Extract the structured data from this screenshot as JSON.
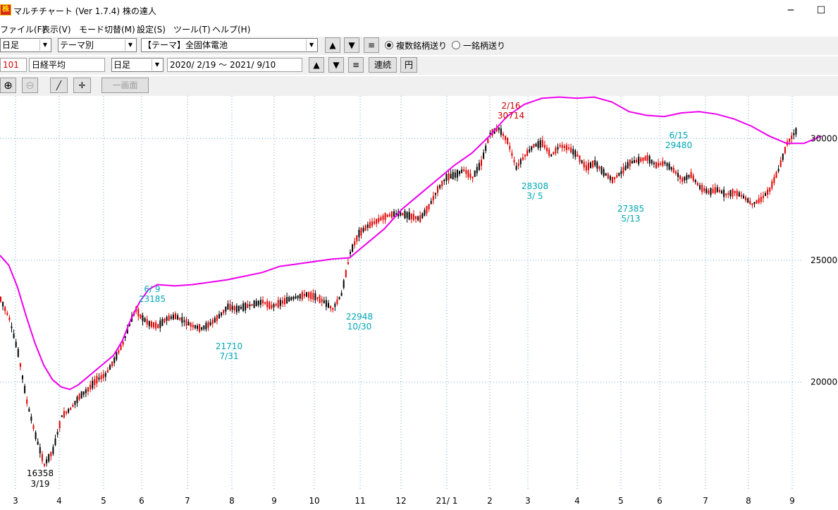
{
  "window": {
    "app_icon_text": "株",
    "title": "マルチチャート (Ver 1.7.4)  株の達人",
    "minimize": "─",
    "maximize": "☐"
  },
  "menu": [
    "ファイル(F)",
    "表示(V)",
    "モード切替(M)",
    "設定(S)",
    "ツール(T)",
    "ヘルプ(H)"
  ],
  "toolbar1": {
    "period": "日足",
    "list_type": "テーマ別",
    "theme": "【テーマ】全固体電池",
    "up_label": "▲",
    "down_label": "▼",
    "list_label": "≡",
    "radio_multi_label": "複数銘柄送り",
    "radio_single_label": "一銘柄送り"
  },
  "toolbar2": {
    "code": "101",
    "name": "日経平均",
    "period": "日足",
    "date_range": "2020/ 2/19 ～  2021/ 9/10",
    "up_label": "▲",
    "down_label": "▼",
    "list_label": "≡",
    "continuous_label": "連続",
    "yen_label": "円"
  },
  "toolbar3": {
    "zoom_in": "⊕",
    "zoom_out": "⊖",
    "line_tool": "╱",
    "crosshair": "✛",
    "single_screen": "一画面"
  },
  "chart_data": {
    "type": "candlestick",
    "y_ticks": [
      20000,
      25000,
      30000
    ],
    "x_ticks": [
      "3",
      "4",
      "5",
      "6",
      "7",
      "8",
      "9",
      "10",
      "11",
      "12",
      "21/ 1",
      "2",
      "3",
      "4",
      "5",
      "6",
      "7",
      "8",
      "9"
    ],
    "grid": true,
    "colors": {
      "up": "#e00000",
      "down": "#000000",
      "moving_average": "#ee00ee",
      "high_label": "#cc0000",
      "low_label": "#00a6b4",
      "grid": "#6ba7d4"
    },
    "annotations": [
      {
        "value": "16358",
        "date": "3/19",
        "kind": "low"
      },
      {
        "value": "23185",
        "date": "6/ 9",
        "kind": "high"
      },
      {
        "value": "21710",
        "date": "7/31",
        "kind": "low"
      },
      {
        "value": "22948",
        "date": "10/30",
        "kind": "low"
      },
      {
        "value": "30714",
        "date": "2/16",
        "kind": "high"
      },
      {
        "value": "28308",
        "date": "3/ 5",
        "kind": "low"
      },
      {
        "value": "27385",
        "date": "5/13",
        "kind": "low"
      },
      {
        "value": "29480",
        "date": "6/15",
        "kind": "high"
      }
    ],
    "price_path": [
      [
        0,
        23400
      ],
      [
        2,
        22600
      ],
      [
        4,
        21200
      ],
      [
        6,
        19200
      ],
      [
        8,
        17800
      ],
      [
        10,
        16600
      ],
      [
        12,
        17200
      ],
      [
        14,
        18600
      ],
      [
        16,
        18900
      ],
      [
        18,
        19400
      ],
      [
        20,
        19700
      ],
      [
        22,
        20100
      ],
      [
        24,
        20300
      ],
      [
        26,
        20900
      ],
      [
        28,
        21600
      ],
      [
        30,
        22600
      ],
      [
        31,
        23000
      ],
      [
        32,
        22700
      ],
      [
        34,
        22400
      ],
      [
        36,
        22300
      ],
      [
        38,
        22600
      ],
      [
        40,
        22700
      ],
      [
        42,
        22500
      ],
      [
        44,
        22300
      ],
      [
        46,
        22200
      ],
      [
        48,
        22400
      ],
      [
        50,
        22700
      ],
      [
        52,
        23100
      ],
      [
        54,
        23000
      ],
      [
        56,
        23100
      ],
      [
        58,
        23200
      ],
      [
        60,
        23300
      ],
      [
        62,
        23100
      ],
      [
        64,
        23250
      ],
      [
        66,
        23400
      ],
      [
        68,
        23500
      ],
      [
        70,
        23600
      ],
      [
        72,
        23500
      ],
      [
        74,
        23300
      ],
      [
        76,
        23000
      ],
      [
        78,
        23600
      ],
      [
        80,
        25300
      ],
      [
        82,
        26100
      ],
      [
        84,
        26400
      ],
      [
        86,
        26600
      ],
      [
        88,
        26800
      ],
      [
        90,
        26900
      ],
      [
        92,
        26900
      ],
      [
        94,
        26800
      ],
      [
        96,
        26700
      ],
      [
        98,
        27200
      ],
      [
        100,
        27900
      ],
      [
        102,
        28400
      ],
      [
        104,
        28500
      ],
      [
        106,
        28700
      ],
      [
        108,
        28400
      ],
      [
        110,
        29000
      ],
      [
        112,
        30200
      ],
      [
        114,
        30400
      ],
      [
        116,
        29900
      ],
      [
        118,
        28800
      ],
      [
        120,
        29300
      ],
      [
        122,
        29700
      ],
      [
        124,
        29800
      ],
      [
        126,
        29300
      ],
      [
        128,
        29700
      ],
      [
        130,
        29600
      ],
      [
        132,
        29300
      ],
      [
        134,
        28800
      ],
      [
        136,
        29000
      ],
      [
        138,
        28600
      ],
      [
        140,
        28300
      ],
      [
        142,
        28600
      ],
      [
        144,
        29000
      ],
      [
        146,
        29100
      ],
      [
        148,
        29200
      ],
      [
        150,
        28900
      ],
      [
        152,
        29000
      ],
      [
        154,
        28700
      ],
      [
        156,
        28300
      ],
      [
        158,
        28500
      ],
      [
        160,
        28000
      ],
      [
        162,
        27800
      ],
      [
        164,
        27900
      ],
      [
        166,
        27700
      ],
      [
        168,
        27800
      ],
      [
        170,
        27600
      ],
      [
        172,
        27300
      ],
      [
        174,
        27500
      ],
      [
        176,
        27900
      ],
      [
        178,
        28700
      ],
      [
        180,
        29800
      ],
      [
        182,
        30300
      ]
    ],
    "moving_average_path": [
      [
        0,
        25200
      ],
      [
        2,
        24800
      ],
      [
        4,
        23900
      ],
      [
        6,
        22700
      ],
      [
        8,
        21600
      ],
      [
        10,
        20700
      ],
      [
        12,
        20100
      ],
      [
        14,
        19800
      ],
      [
        16,
        19700
      ],
      [
        18,
        19900
      ],
      [
        20,
        20200
      ],
      [
        22,
        20500
      ],
      [
        24,
        20800
      ],
      [
        26,
        21100
      ],
      [
        28,
        21700
      ],
      [
        30,
        22600
      ],
      [
        32,
        23300
      ],
      [
        34,
        23800
      ],
      [
        36,
        24000
      ],
      [
        40,
        23950
      ],
      [
        44,
        24000
      ],
      [
        48,
        24100
      ],
      [
        52,
        24200
      ],
      [
        56,
        24350
      ],
      [
        60,
        24500
      ],
      [
        64,
        24750
      ],
      [
        68,
        24850
      ],
      [
        72,
        24950
      ],
      [
        76,
        25050
      ],
      [
        80,
        25100
      ],
      [
        84,
        25700
      ],
      [
        88,
        26300
      ],
      [
        92,
        27100
      ],
      [
        96,
        27700
      ],
      [
        100,
        28300
      ],
      [
        104,
        28900
      ],
      [
        108,
        29400
      ],
      [
        112,
        30100
      ],
      [
        116,
        30900
      ],
      [
        120,
        31400
      ],
      [
        124,
        31650
      ],
      [
        128,
        31700
      ],
      [
        132,
        31650
      ],
      [
        136,
        31700
      ],
      [
        140,
        31500
      ],
      [
        144,
        31100
      ],
      [
        148,
        30950
      ],
      [
        152,
        30900
      ],
      [
        156,
        31050
      ],
      [
        160,
        31100
      ],
      [
        164,
        31000
      ],
      [
        168,
        30800
      ],
      [
        172,
        30500
      ],
      [
        176,
        30100
      ],
      [
        180,
        29800
      ],
      [
        184,
        29800
      ],
      [
        188,
        30100
      ]
    ]
  }
}
